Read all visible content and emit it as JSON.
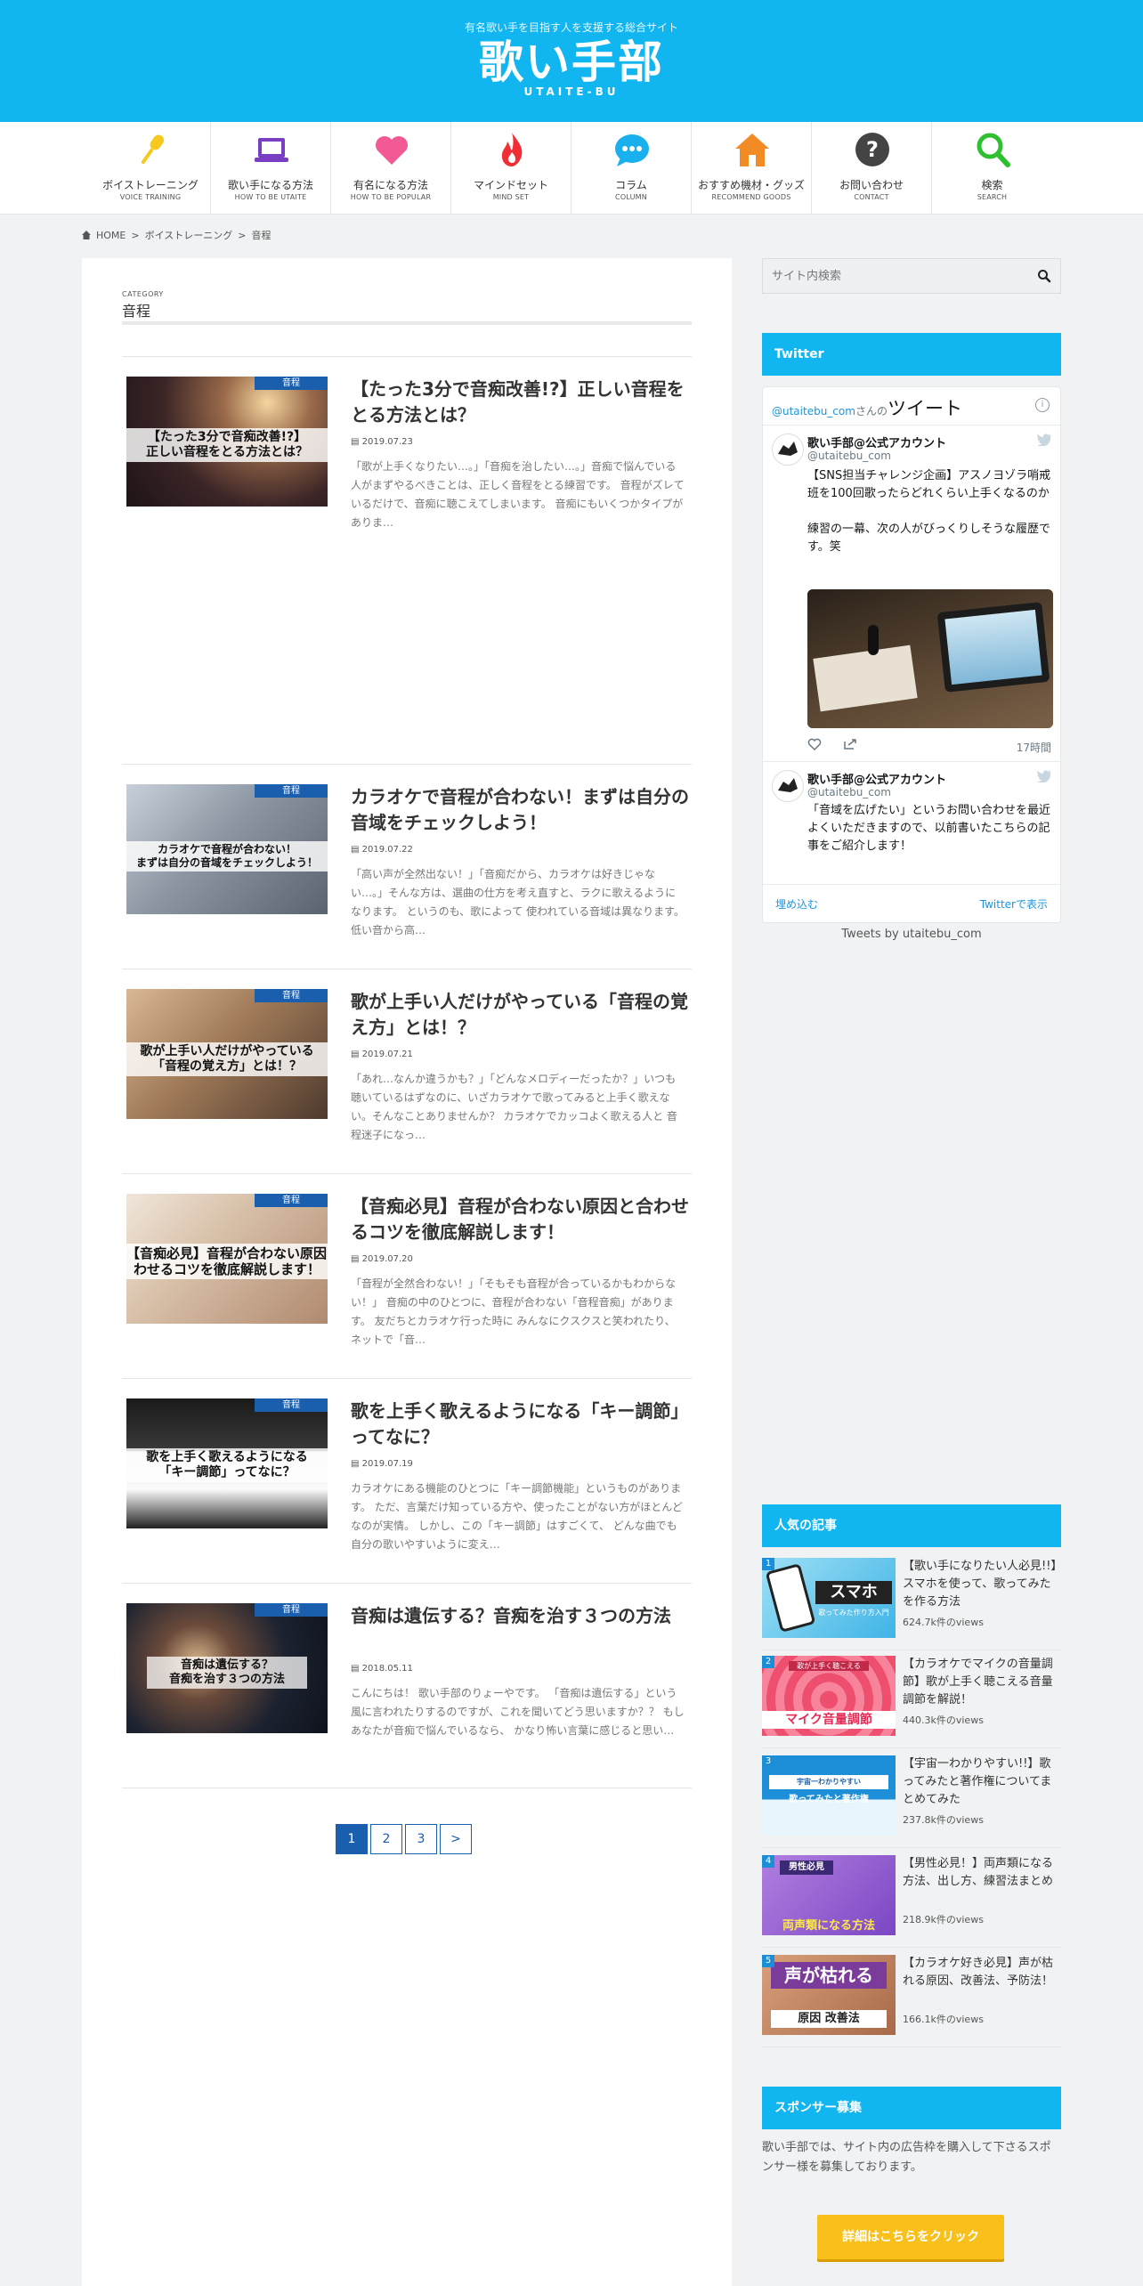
{
  "header": {
    "tagline": "有名歌い手を目指す人を支援する総合サイト",
    "logo_main": "歌い手部",
    "logo_sub": "UTAITE-BU"
  },
  "nav": [
    {
      "label": "ボイストレーニング",
      "sub": "VOICE TRAINING",
      "icon": "microphone-icon",
      "color": "#f7c91e"
    },
    {
      "label": "歌い手になる方法",
      "sub": "HOW TO BE UTAITE",
      "icon": "laptop-icon",
      "color": "#7a3ec2"
    },
    {
      "label": "有名になる方法",
      "sub": "HOW TO BE POPULAR",
      "icon": "heart-icon",
      "color": "#f25a95"
    },
    {
      "label": "マインドセット",
      "sub": "MIND SET",
      "icon": "flame-icon",
      "color": "#ef2f35"
    },
    {
      "label": "コラム",
      "sub": "COLUMN",
      "icon": "chat-bubble-icon",
      "color": "#1ab0ee"
    },
    {
      "label": "おすすめ機材・グッズ",
      "sub": "RECOMMEND GOODS",
      "icon": "house-icon",
      "color": "#f38b25"
    },
    {
      "label": "お問い合わせ",
      "sub": "CONTACT",
      "icon": "question-icon",
      "color": "#444444"
    },
    {
      "label": "検索",
      "sub": "SEARCH",
      "icon": "search-icon",
      "color": "#2fc02f"
    }
  ],
  "breadcrumb": [
    "HOME",
    ">",
    "ボイストレーニング",
    ">",
    "音程"
  ],
  "category": {
    "label": "CATEGORY",
    "name": "音程"
  },
  "posts": [
    {
      "category": "音程",
      "thumb_caption": [
        "【たった3分で音痴改善!?】",
        "正しい音程をとる方法とは？"
      ],
      "title": "【たった3分で音痴改善!?】正しい音程をとる方法とは？",
      "date": "2019.07.23",
      "excerpt": "「歌が上手くなりたい…。」「音痴を治したい…。」音痴で悩んでいる人がまずやるべきことは、正しく音程をとる練習です。 音程がズレているだけで、音痴に聴こえてしまいます。 音痴にもいくつかタイプがありま…"
    },
    {
      "category": "音程",
      "thumb_caption": [
        "カラオケで音程が合わない！",
        "まずは自分の音域をチェックしよう！"
      ],
      "title": "カラオケで音程が合わない！まずは自分の音域をチェックしよう！",
      "date": "2019.07.22",
      "excerpt": "「高い声が全然出ない！」「音痴だから、カラオケは好きじゃない…。」そんな方は、選曲の仕方を考え直すと、ラクに歌えるようになります。 というのも、歌によって 使われている音域は異なります。 低い音から高…"
    },
    {
      "category": "音程",
      "thumb_caption": [
        "歌が上手い人だけがやっている",
        "「音程の覚え方」とは！？"
      ],
      "title": "歌が上手い人だけがやっている「音程の覚え方」とは！？",
      "date": "2019.07.21",
      "excerpt": "「あれ…なんか違うかも？」「どんなメロディーだったか？」いつも聴いているはずなのに、いざカラオケで歌ってみると上手く歌えない。そんなことありませんか？ カラオケでカッコよく歌える人と 音程迷子になっ…"
    },
    {
      "category": "音程",
      "thumb_caption": [
        "【音痴必見】音程が合わない原因と合",
        "わせるコツを徹底解説します！"
      ],
      "title": "【音痴必見】音程が合わない原因と合わせるコツを徹底解説します！",
      "date": "2019.07.20",
      "excerpt": "「音程が全然合わない！」「そもそも音程が合っているかもわからない！」 音痴の中のひとつに、音程が合わない「音程音痴」があります。 友だちとカラオケ行った時に みんなにクスクスと笑われたり、ネットで「音…"
    },
    {
      "category": "音程",
      "thumb_caption": [
        "歌を上手く歌えるようになる",
        "「キー調節」ってなに？"
      ],
      "title": "歌を上手く歌えるようになる「キー調節」ってなに？",
      "date": "2019.07.19",
      "excerpt": "カラオケにある機能のひとつに「キー調節機能」というものがあります。 ただ、言葉だけ知っている方や、使ったことがない方がほとんどなのが実情。 しかし、この「キー調節」はすごくて、 どんな曲でも自分の歌いやすいように変え…"
    },
    {
      "category": "音程",
      "thumb_caption": [
        "音痴は遺伝する？",
        "音痴を治す３つの方法"
      ],
      "title": "音痴は遺伝する？音痴を治す３つの方法",
      "date": "2018.05.11",
      "excerpt": "こんにちは！ 歌い手部のりょーやです。 「音痴は遺伝する」という風に言われたりするのですが、これを聞いてどう思いますか？？ もしあなたが音痴で悩んでいるなら、 かなり怖い言葉に感じると思い…"
    }
  ],
  "pagination": [
    "1",
    "2",
    "3",
    ">"
  ],
  "sidebar": {
    "search_placeholder": "サイト内検索",
    "twitter_title": "Twitter",
    "twitter": {
      "header_handle": "@utaitebu_com",
      "header_san": "さんの",
      "header_strong": "ツイート",
      "tweet1": {
        "name": "歌い手部@公式アカウント",
        "handle": "@utaitebu_com",
        "text": "【SNS担当チャレンジ企画】アスノヨゾラ哨戒班を100回歌ったらどれくらい上手くなるのか\n\n練習の一幕、次の人がびっくりしそうな履歴です。笑",
        "time": "17時間"
      },
      "tweet2": {
        "name": "歌い手部@公式アカウント",
        "handle": "@utaitebu_com",
        "text": "「音域を広げたい」というお問い合わせを最近よくいただきますので、以前書いたこちらの記事をご紹介します！"
      },
      "embed": "埋め込む",
      "view_on": "Twitterで表示",
      "tweets_by": "Tweets by utaitebu_com"
    },
    "popular_title": "人気の記事",
    "popular": [
      {
        "rank": "1",
        "title": "【歌い手になりたい人必見!!】スマホを使って、歌ってみたを作る方法",
        "views": "624.7k件のviews",
        "thumb_text": "スマホ",
        "thumb_sub": "歌ってみた作り方入門"
      },
      {
        "rank": "2",
        "title": "【カラオケでマイクの音量調節】歌が上手く聴こえる音量調節を解説！",
        "views": "440.3k件のviews",
        "thumb_text": "マイク音量調節",
        "thumb_sub": "歌が上手く聴こえる"
      },
      {
        "rank": "3",
        "title": "【宇宙一わかりやすい!!】歌ってみたと著作権についてまとめてみた",
        "views": "237.8k件のviews",
        "thumb_text": "歌ってみたと著作権",
        "thumb_sub": "宇宙一わかりやすい"
      },
      {
        "rank": "4",
        "title": "【男性必見！】両声類になる方法、出し方、練習法まとめ",
        "views": "218.9k件のviews",
        "thumb_text": "両声類になる方法",
        "thumb_sub": "男性必見"
      },
      {
        "rank": "5",
        "title": "【カラオケ好き必見】声が枯れる原因、改善法、予防法！",
        "views": "166.1k件のviews",
        "thumb_text": "声が枯れる",
        "thumb_sub": "原因 改善法"
      }
    ],
    "sponsor_title": "スポンサー募集",
    "sponsor_text": "歌い手部では、サイト内の広告枠を購入して下さるスポンサー様を募集しております。",
    "sponsor_button": "詳細はこちらをクリック"
  },
  "colors": {
    "brand": "#11b5f0",
    "category_tag": "#1a5fad",
    "sponsor_button": "#f9c01c"
  }
}
